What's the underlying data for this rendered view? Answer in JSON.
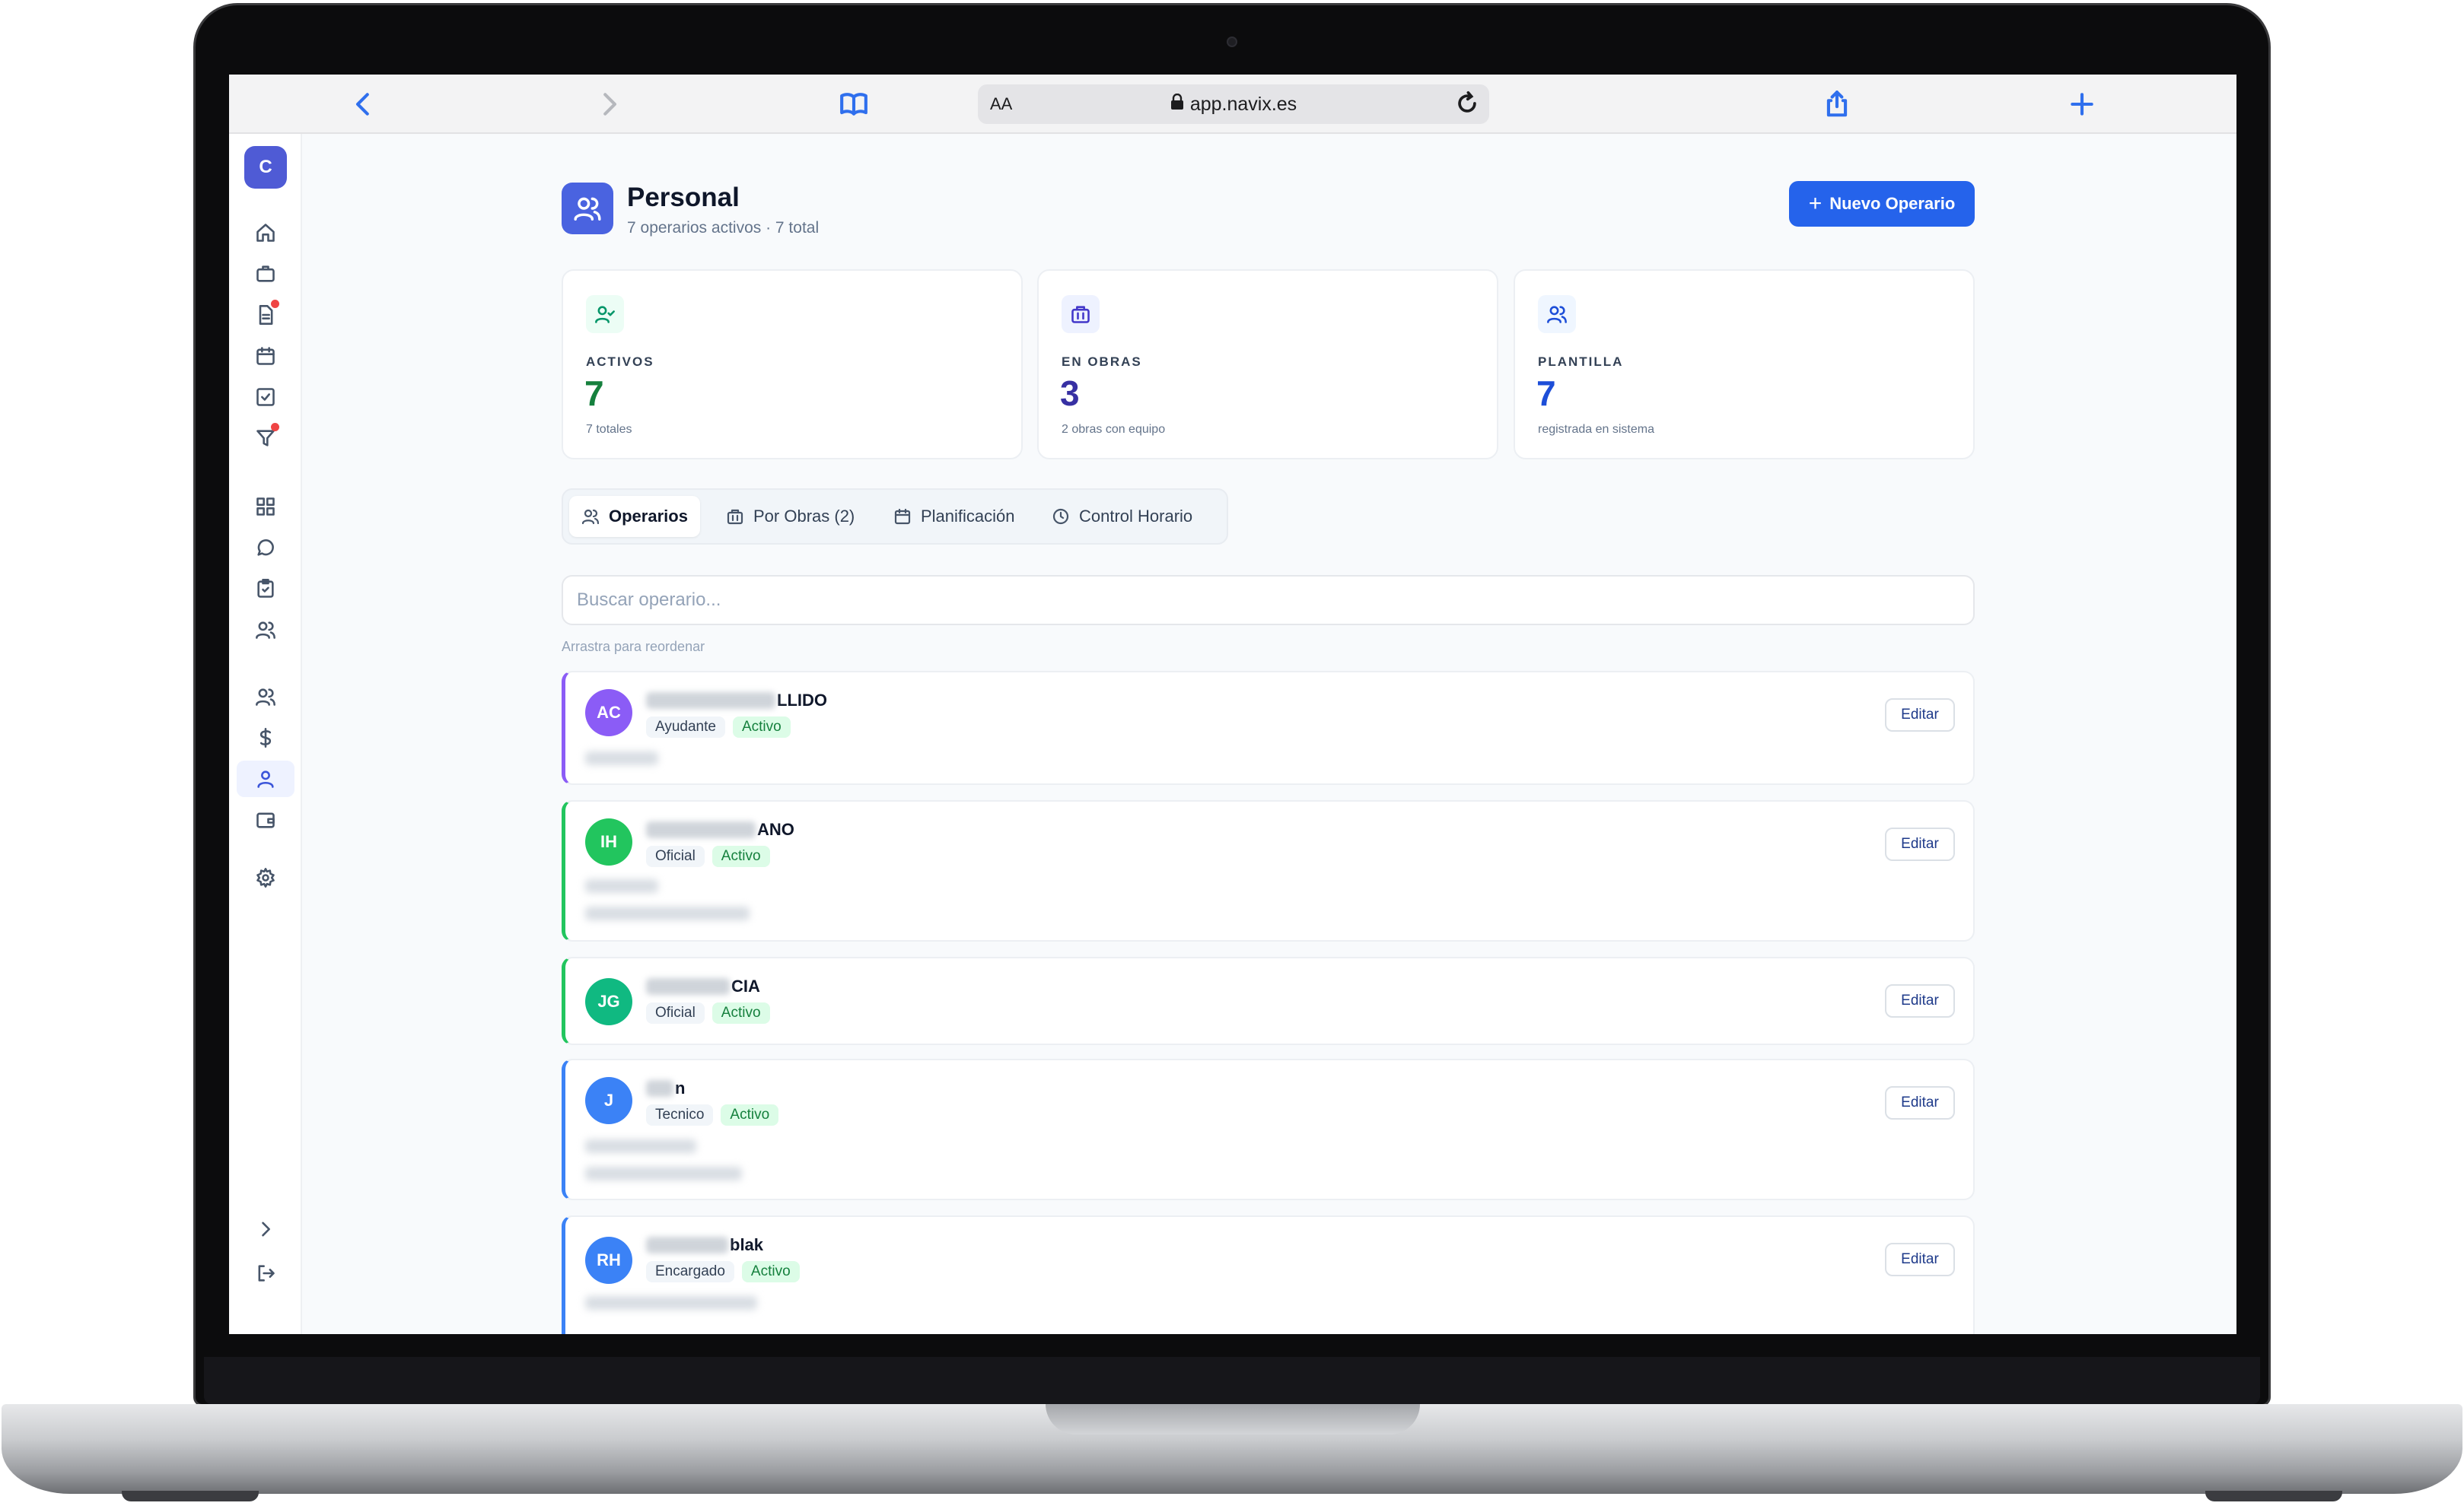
{
  "browser": {
    "aa_label": "AA",
    "url": "app.navix.es"
  },
  "sidebar": {
    "org_initial": "C",
    "items": [
      {
        "icon": "home-icon"
      },
      {
        "icon": "briefcase-icon"
      },
      {
        "icon": "document-icon",
        "badge": true
      },
      {
        "icon": "calendar-icon"
      },
      {
        "icon": "checkbox-icon"
      },
      {
        "icon": "filter-icon",
        "badge": true
      },
      {
        "icon": "grid-icon"
      },
      {
        "icon": "chat-icon"
      },
      {
        "icon": "clipboard-icon"
      },
      {
        "icon": "users-icon"
      },
      {
        "icon": "team-icon"
      },
      {
        "icon": "dollar-icon"
      },
      {
        "icon": "user-icon",
        "active": true
      },
      {
        "icon": "wallet-icon"
      },
      {
        "icon": "gear-icon"
      },
      {
        "icon": "chevron-right-icon"
      },
      {
        "icon": "logout-icon"
      }
    ]
  },
  "header": {
    "title": "Personal",
    "subtitle": "7 operarios activos · 7 total",
    "new_button": "Nuevo Operario"
  },
  "stats": [
    {
      "label": "ACTIVOS",
      "value": "7",
      "note": "7 totales",
      "color": "#15803d",
      "icon": "user-check-icon"
    },
    {
      "label": "EN OBRAS",
      "value": "3",
      "note": "2 obras con equipo",
      "color": "#3730a3",
      "icon": "building-icon"
    },
    {
      "label": "PLANTILLA",
      "value": "7",
      "note": "registrada en sistema",
      "color": "#1d4ed8",
      "icon": "users-icon"
    }
  ],
  "tabs": [
    {
      "label": "Operarios",
      "active": true
    },
    {
      "label": "Por Obras (2)"
    },
    {
      "label": "Planificación"
    },
    {
      "label": "Control Horario"
    }
  ],
  "search": {
    "placeholder": "Buscar operario..."
  },
  "drag_hint": "Arrastra para reordenar",
  "operators": [
    {
      "initials": "AC",
      "name_visible": "LLIDO",
      "role": "Ayudante",
      "status": "Activo",
      "avatar_color": "#8b5cf6",
      "accent": "#8b5cf6",
      "edit": "Editar"
    },
    {
      "initials": "IH",
      "name_visible": "ANO",
      "role": "Oficial",
      "status": "Activo",
      "avatar_color": "#22c55e",
      "accent": "#22c55e",
      "edit": "Editar"
    },
    {
      "initials": "JG",
      "name_visible": "CIA",
      "role": "Oficial",
      "status": "Activo",
      "avatar_color": "#10b981",
      "accent": "#22c55e",
      "edit": "Editar"
    },
    {
      "initials": "J",
      "name_visible": "n",
      "role": "Tecnico",
      "status": "Activo",
      "avatar_color": "#3b82f6",
      "accent": "#3b82f6",
      "edit": "Editar"
    },
    {
      "initials": "RH",
      "name_visible": "blak",
      "role": "Encargado",
      "status": "Activo",
      "avatar_color": "#3b82f6",
      "accent": "#3b82f6",
      "edit": "Editar"
    }
  ]
}
